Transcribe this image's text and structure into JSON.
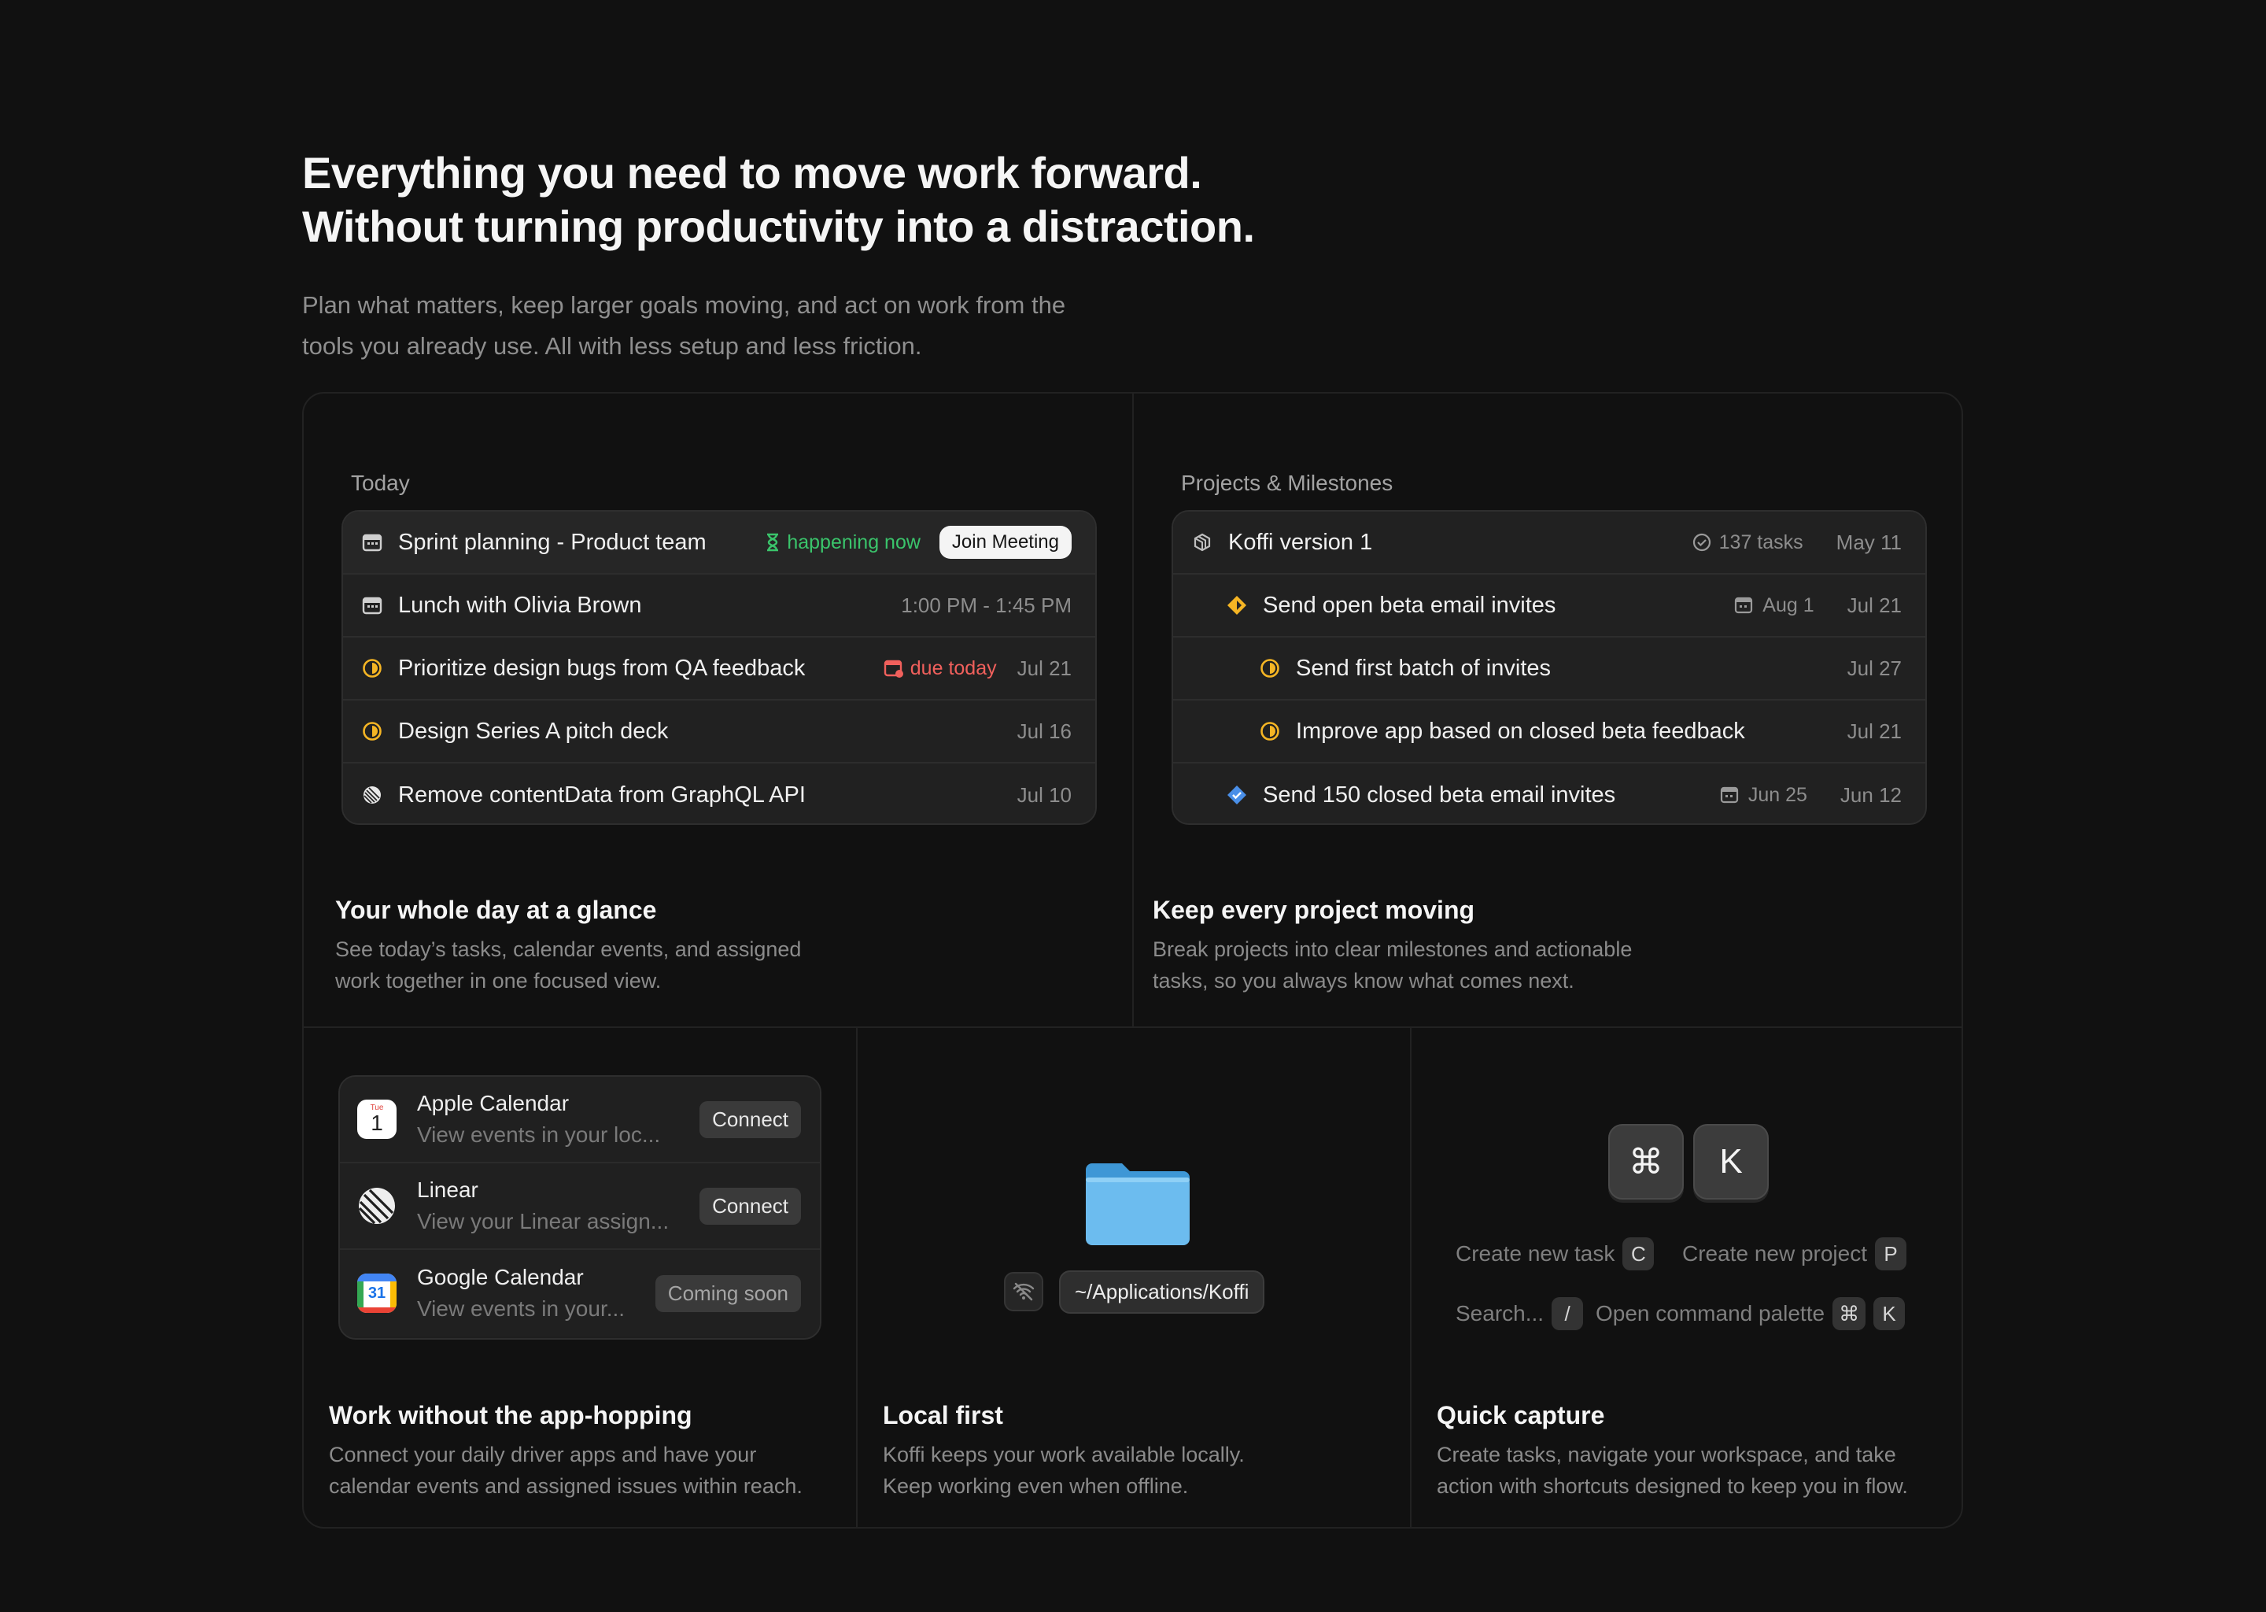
{
  "hero": {
    "title_line1": "Everything you need to move work forward.",
    "title_line2": "Without turning productivity into a distraction.",
    "sub_line1": "Plan what matters, keep larger goals moving, and act on work from the",
    "sub_line2": "tools you already use. All with less setup and less friction."
  },
  "today": {
    "label": "Today",
    "rows": [
      {
        "title": "Sprint planning - Product team",
        "status": "happening now",
        "action": "Join Meeting",
        "icon": "calendar-icon"
      },
      {
        "title": "Lunch with Olivia Brown",
        "meta": "1:00 PM - 1:45 PM",
        "icon": "calendar-icon"
      },
      {
        "title": "Prioritize design bugs from QA feedback",
        "status": "due today",
        "meta": "Jul 21",
        "icon": "in-progress-icon"
      },
      {
        "title": "Design Series A pitch deck",
        "meta": "Jul 16",
        "icon": "in-progress-icon"
      },
      {
        "title": "Remove contentData from GraphQL API",
        "meta": "Jul 10",
        "icon": "linear-icon"
      }
    ],
    "feature_title": "Your whole day at a glance",
    "feature_desc_1": "See today’s tasks, calendar events, and assigned",
    "feature_desc_2": "work together in one focused view."
  },
  "projects": {
    "label": "Projects & Milestones",
    "rows": [
      {
        "title": "Koffi version 1",
        "tasks": "137 tasks",
        "meta": "May 11",
        "icon": "project-icon"
      },
      {
        "title": "Send open beta email invites",
        "sub": "Aug 1",
        "meta": "Jul 21",
        "icon": "milestone-icon"
      },
      {
        "title": "Send first batch of invites",
        "meta": "Jul 27",
        "icon": "in-progress-icon"
      },
      {
        "title": "Improve app based on closed beta feedback",
        "meta": "Jul 21",
        "icon": "in-progress-icon"
      },
      {
        "title": "Send 150 closed beta email invites",
        "sub": "Jun 25",
        "meta": "Jun 12",
        "icon": "milestone-done-icon"
      }
    ],
    "feature_title": "Keep every project moving",
    "feature_desc_1": "Break projects into clear milestones and actionable",
    "feature_desc_2": "tasks, so you always know what comes next."
  },
  "integrations": {
    "items": [
      {
        "name": "Apple Calendar",
        "desc": "View events in your loc...",
        "action": "Connect",
        "logo_day": "Tue",
        "logo_num": "1"
      },
      {
        "name": "Linear",
        "desc": "View your Linear assign...",
        "action": "Connect"
      },
      {
        "name": "Google Calendar",
        "desc": "View events in your...",
        "action": "Coming soon",
        "logo_num": "31"
      }
    ],
    "feature_title": "Work without the app-hopping",
    "feature_desc_1": "Connect your daily driver apps and have your",
    "feature_desc_2": "calendar events and assigned issues within reach."
  },
  "local": {
    "path": "~/Applications/Koffi",
    "feature_title": "Local first",
    "feature_desc_1": "Koffi keeps your work available locally.",
    "feature_desc_2": "Keep working even when offline."
  },
  "capture": {
    "key1": "⌘",
    "key2": "K",
    "shortcuts": [
      {
        "label": "Create new task",
        "keys": [
          "C"
        ]
      },
      {
        "label": "Create new project",
        "keys": [
          "P"
        ]
      },
      {
        "label": "Search...",
        "keys": [
          "/"
        ]
      },
      {
        "label": "Open command palette",
        "keys": [
          "⌘",
          "K"
        ]
      }
    ],
    "feature_title": "Quick capture",
    "feature_desc_1": "Create tasks, navigate your workspace, and take",
    "feature_desc_2": "action with shortcuts designed to keep you in flow."
  },
  "colors": {
    "background": "#111111",
    "accent_green": "#3ac46b",
    "accent_red": "#f0605c",
    "accent_yellow": "#f5b524",
    "accent_blue": "#4a8fe8"
  }
}
